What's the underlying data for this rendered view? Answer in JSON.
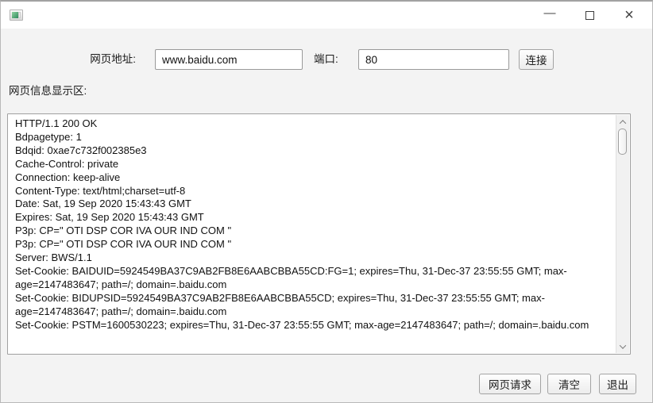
{
  "window": {
    "title": "",
    "controls": {
      "minimize_glyph": "—",
      "close_glyph": "×"
    }
  },
  "form": {
    "address_label": "网页地址:",
    "address_value": "www.baidu.com",
    "port_label": "端口:",
    "port_value": "80",
    "connect_button": "连接"
  },
  "display": {
    "label": "网页信息显示区:",
    "content_lines": [
      "HTTP/1.1 200 OK",
      "Bdpagetype: 1",
      "Bdqid: 0xae7c732f002385e3",
      "Cache-Control: private",
      "Connection: keep-alive",
      "Content-Type: text/html;charset=utf-8",
      "Date: Sat, 19 Sep 2020 15:43:43 GMT",
      "Expires: Sat, 19 Sep 2020 15:43:43 GMT",
      "P3p: CP=\" OTI DSP COR IVA OUR IND COM \"",
      "P3p: CP=\" OTI DSP COR IVA OUR IND COM \"",
      "Server: BWS/1.1",
      "Set-Cookie: BAIDUID=5924549BA37C9AB2FB8E6AABCBBA55CD:FG=1; expires=Thu, 31-Dec-37 23:55:55 GMT; max-age=2147483647; path=/; domain=.baidu.com",
      "Set-Cookie: BIDUPSID=5924549BA37C9AB2FB8E6AABCBBA55CD; expires=Thu, 31-Dec-37 23:55:55 GMT; max-age=2147483647; path=/; domain=.baidu.com",
      "Set-Cookie: PSTM=1600530223; expires=Thu, 31-Dec-37 23:55:55 GMT; max-age=2147483647; path=/; domain=.baidu.com"
    ]
  },
  "actions": {
    "request_button": "网页请求",
    "clear_button": "清空",
    "exit_button": "退出"
  },
  "colors": {
    "titlebar_bg": "#ffffff",
    "client_bg": "#f3f3f3",
    "field_border": "#9a9a9a",
    "button_border": "#a3a3a3",
    "app_icon_green": "#2f8b5d"
  }
}
